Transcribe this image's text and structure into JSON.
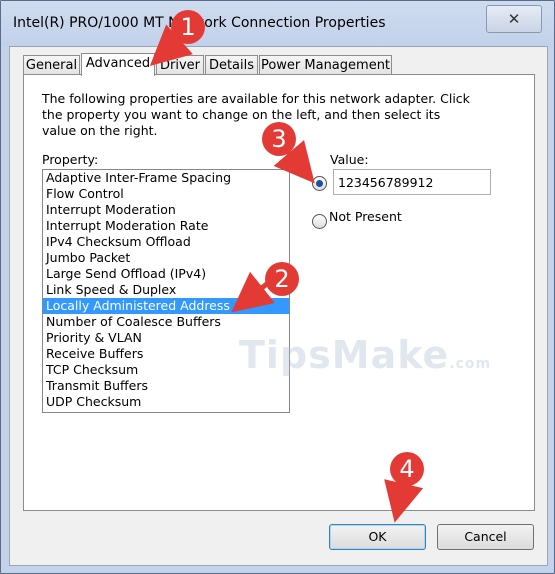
{
  "window": {
    "title": "Intel(R) PRO/1000 MT Network Connection Properties",
    "close_glyph": "✕"
  },
  "tabs": [
    {
      "label": "General",
      "active": false
    },
    {
      "label": "Advanced",
      "active": true
    },
    {
      "label": "Driver",
      "active": false
    },
    {
      "label": "Details",
      "active": false
    },
    {
      "label": "Power Management",
      "active": false
    }
  ],
  "advanced": {
    "description": "The following properties are available for this network adapter. Click the property you want to change on the left, and then select its value on the right.",
    "property_label": "Property:",
    "value_label": "Value:",
    "properties": [
      "Adaptive Inter-Frame Spacing",
      "Flow Control",
      "Interrupt Moderation",
      "Interrupt Moderation Rate",
      "IPv4 Checksum Offload",
      "Jumbo Packet",
      "Large Send Offload (IPv4)",
      "Link Speed & Duplex",
      "Locally Administered Address",
      "Number of Coalesce Buffers",
      "Priority & VLAN",
      "Receive Buffers",
      "TCP Checksum",
      "Transmit Buffers",
      "UDP Checksum"
    ],
    "selected_property": "Locally Administered Address",
    "value_text": "123456789912",
    "value_radio_checked": true,
    "not_present_label": "Not Present",
    "not_present_checked": false
  },
  "buttons": {
    "ok": "OK",
    "cancel": "Cancel"
  },
  "callouts": [
    "1",
    "2",
    "3",
    "4"
  ],
  "watermark": {
    "text": "TipsMake",
    "tld": ".com"
  },
  "colors": {
    "selection": "#3399ff",
    "callout": "#e43a36",
    "title_bar": "#c4d3ea"
  }
}
